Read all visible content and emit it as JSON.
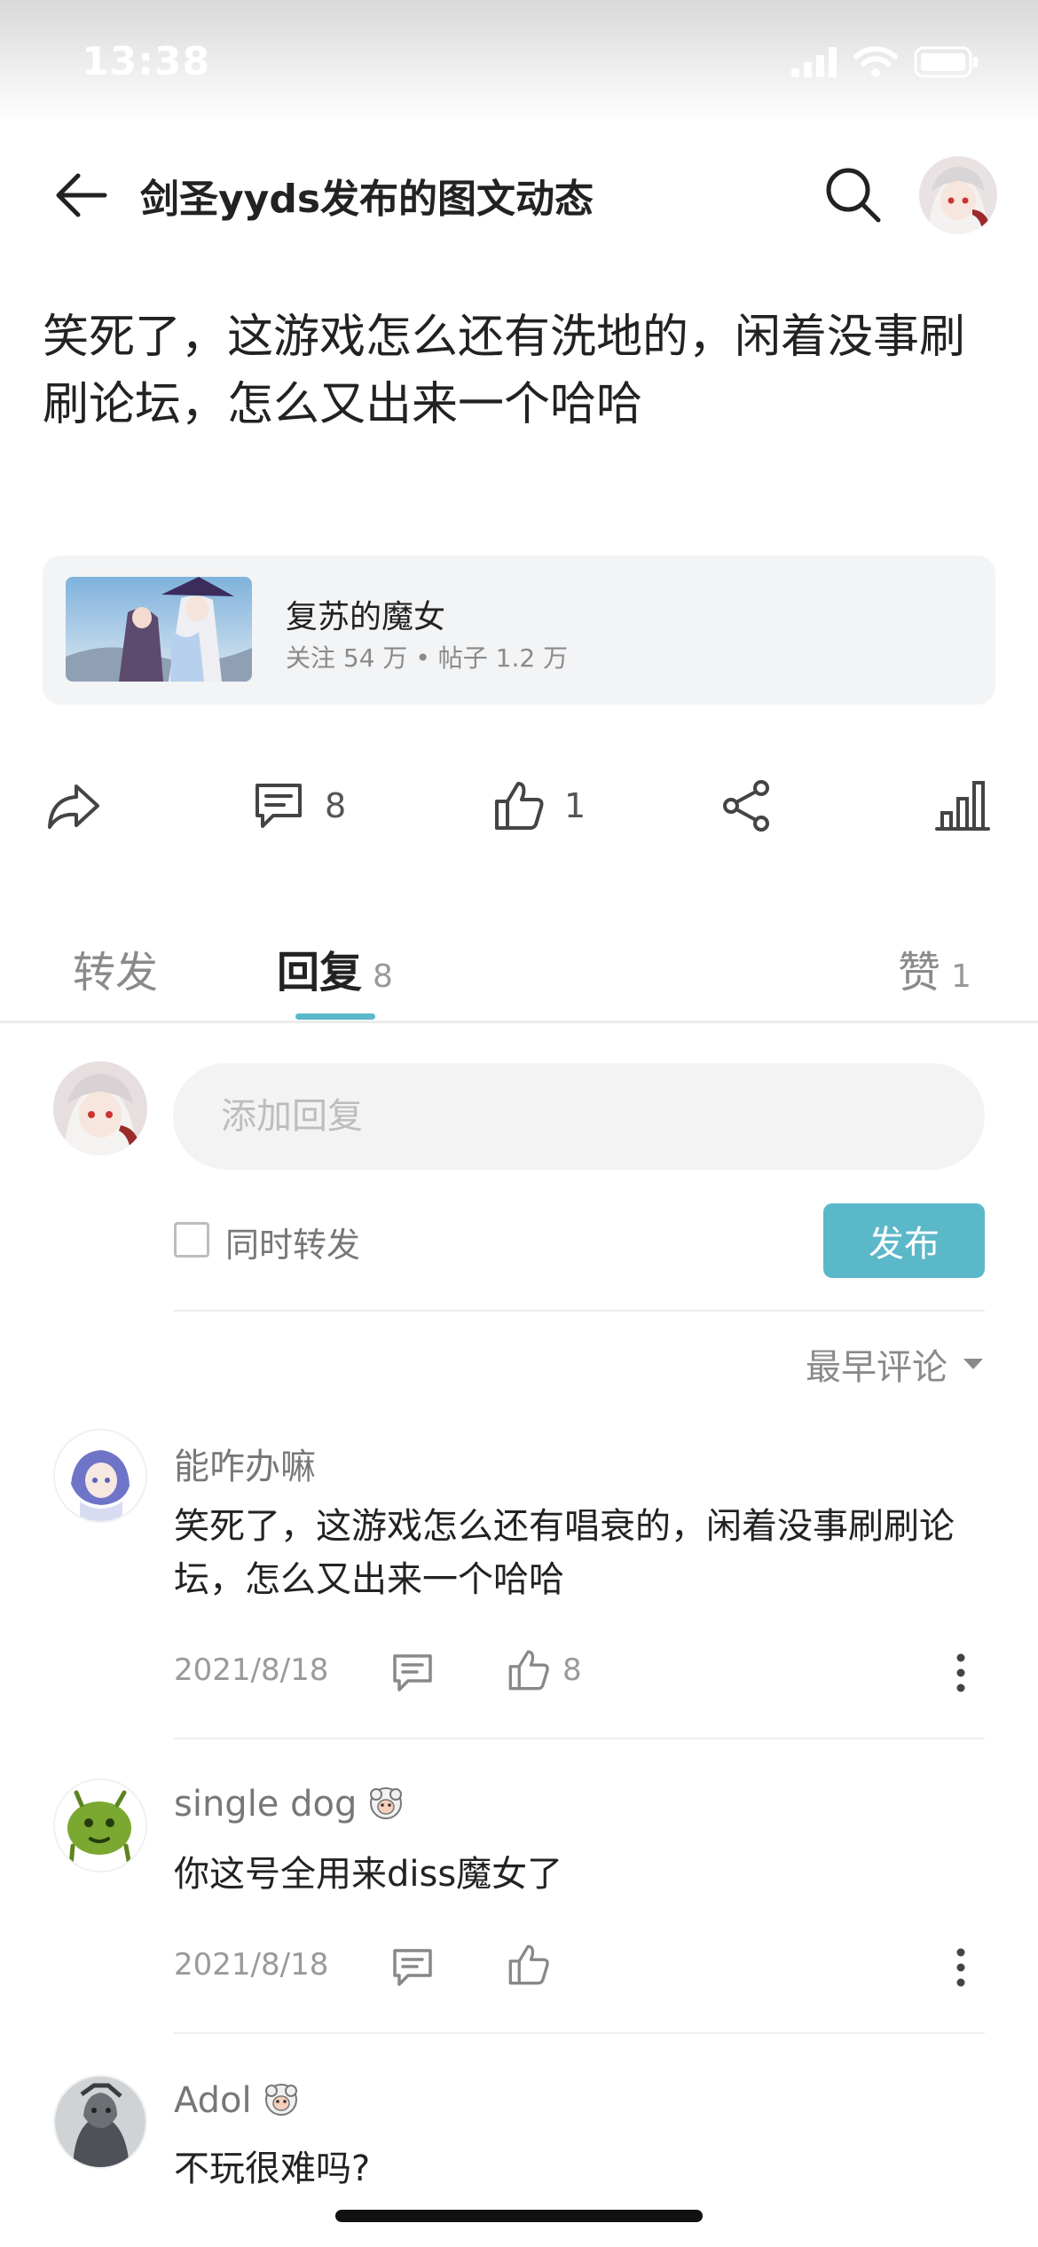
{
  "status_bar": {
    "time": "13:38"
  },
  "header": {
    "title": "剑圣yyds发布的图文动态"
  },
  "post": {
    "body": "笑死了，这游戏怎么还有洗地的，闲着没事刷刷论坛，怎么又出来一个哈哈"
  },
  "game_card": {
    "name": "复苏的魔女",
    "stats": "关注 54 万 • 帖子 1.2 万"
  },
  "actions": {
    "comment_count": "8",
    "like_count": "1"
  },
  "tabs": [
    {
      "label": "转发",
      "count": ""
    },
    {
      "label": "回复",
      "count": "8"
    },
    {
      "label": "赞",
      "count": "1"
    }
  ],
  "composer": {
    "placeholder": "添加回复",
    "forward_label": "同时转发",
    "publish_label": "发布"
  },
  "sort": {
    "label": "最早评论"
  },
  "comments": [
    {
      "user": "能咋办嘛",
      "text": "笑死了，这游戏怎么还有唱衰的，闲着没事刷刷论坛，怎么又出来一个哈哈",
      "date": "2021/8/18",
      "likes": "8"
    },
    {
      "user": "single dog",
      "text": "你这号全用来diss魔女了",
      "date": "2021/8/18",
      "likes": ""
    },
    {
      "user": "Adol",
      "text": "不玩很难吗?",
      "date": "",
      "likes": ""
    }
  ],
  "colors": {
    "accent": "#5bb8c9",
    "text_primary": "#222222",
    "text_secondary": "#8a8a8a",
    "card_bg": "#f3f4f6"
  }
}
